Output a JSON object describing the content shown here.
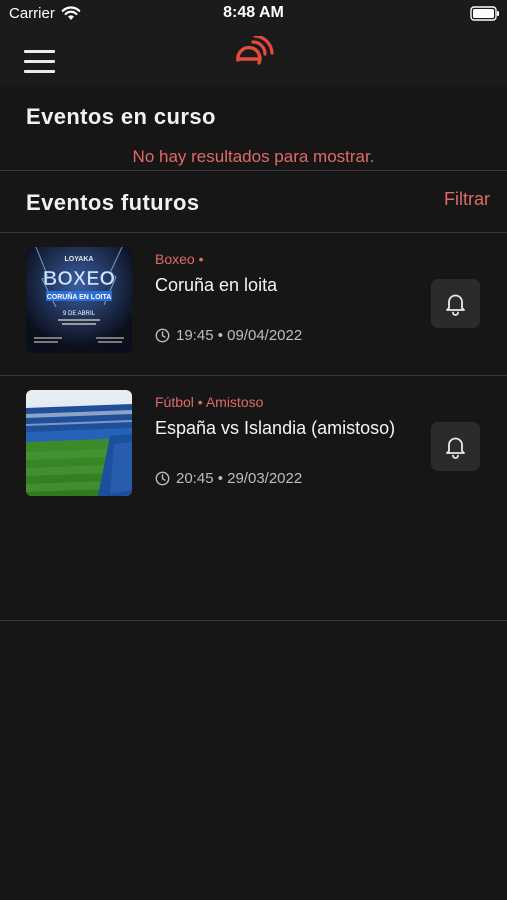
{
  "status_bar": {
    "carrier": "Carrier",
    "time": "8:48 AM"
  },
  "nav": {
    "logo": "e"
  },
  "ongoing": {
    "title": "Eventos en curso",
    "empty_message": "No hay resultados para mostrar."
  },
  "upcoming": {
    "title": "Eventos futuros",
    "filter_label": "Filtrar",
    "events": [
      {
        "category": "Boxeo •",
        "title": "Coruña en loita",
        "datetime": "19:45 • 09/04/2022",
        "poster": {
          "brand": "LOYAKA",
          "headline": "BOXEO",
          "banner": "CORUÑA EN LOITA",
          "date": "9 DE ABRIL"
        }
      },
      {
        "category": "Fútbol • Amistoso",
        "title": "España vs Islandia (amistoso)",
        "datetime": "20:45 • 29/03/2022"
      }
    ]
  },
  "colors": {
    "accent": "#e06a68",
    "background": "#161616",
    "bar": "#1b1b1b",
    "button": "#2b2b2b"
  }
}
